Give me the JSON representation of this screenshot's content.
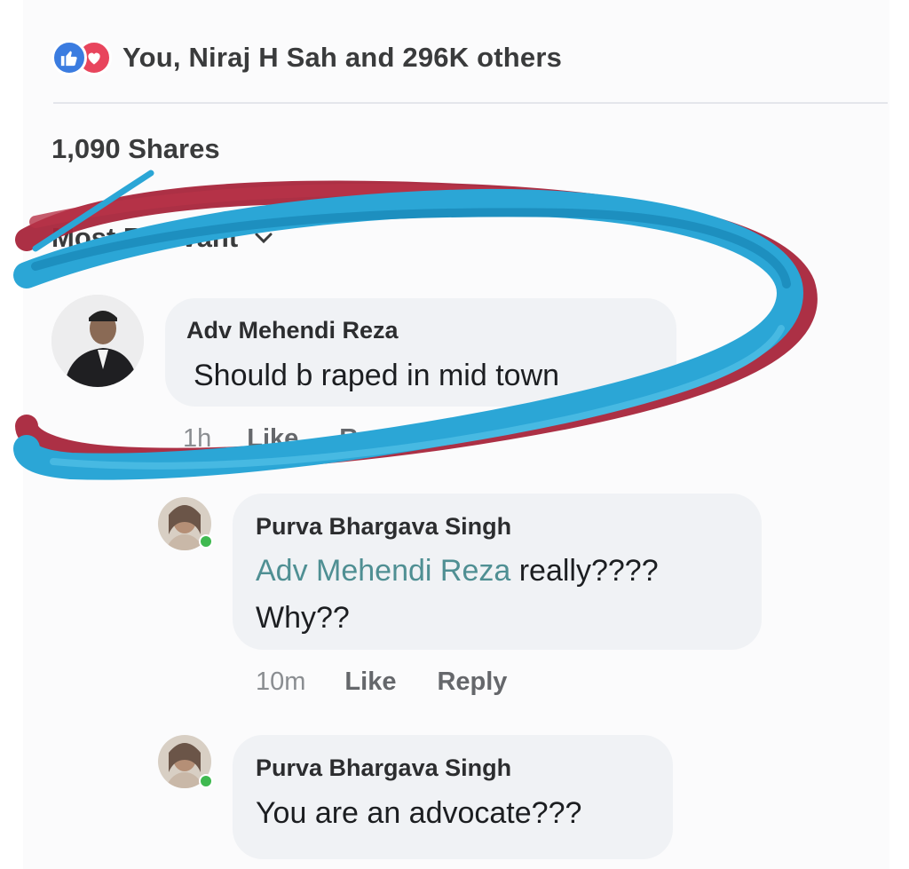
{
  "post": {
    "reactions_text": "You, Niraj H Sah and 296K others",
    "shares_text": "1,090 Shares",
    "sort_label": "Most Relevant",
    "reaction_icons": [
      "like-icon",
      "love-icon"
    ]
  },
  "comments": [
    {
      "author": "Adv Mehendi Reza",
      "text": "Should b raped in mid town",
      "time": "1h",
      "like_label": "Like",
      "reply_label": "Reply"
    },
    {
      "author": "Purva Bhargava Singh",
      "mention": "Adv Mehendi Reza",
      "text_after_mention": " really????",
      "text_line2": "Why??",
      "time": "10m",
      "like_label": "Like",
      "reply_label": "Reply"
    },
    {
      "author": "Purva Bhargava Singh",
      "text": "You are an advocate???"
    }
  ],
  "colors": {
    "like": "#3b7ce0",
    "love": "#e8455d",
    "mention": "#4f8f93",
    "scribble_blue": "#2ba6d6",
    "scribble_red": "#a8253b",
    "online": "#3fb950"
  }
}
